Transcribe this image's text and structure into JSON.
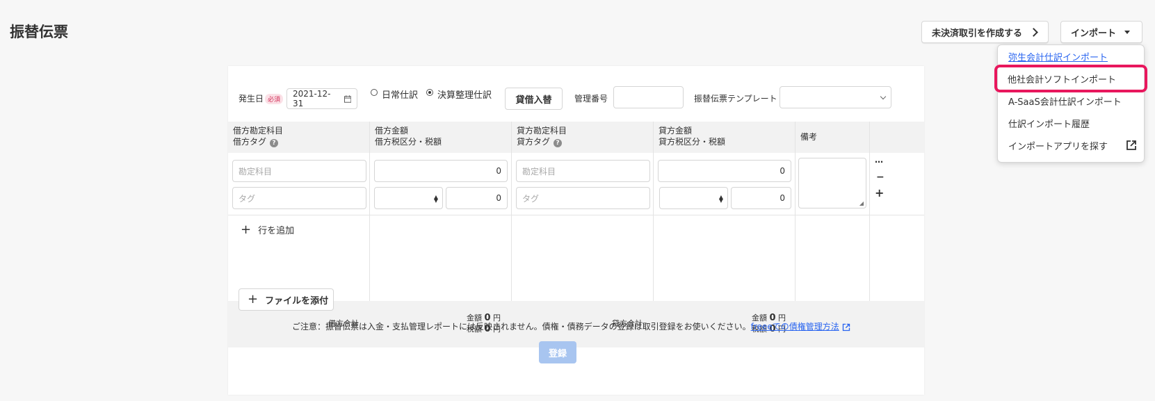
{
  "page": {
    "title": "振替伝票"
  },
  "header": {
    "unsettled_label": "未決済取引を作成する",
    "import_label": "インポート"
  },
  "import_menu": {
    "items": [
      "弥生会計仕訳インポート",
      "他社会計ソフトインポート",
      "A-SaaS会計仕訳インポート",
      "仕訳インポート履歴",
      "インポートアプリを探す"
    ]
  },
  "form": {
    "date_label": "発生日",
    "required_badge": "必須",
    "date_value": "2021-12-31",
    "radio_normal": "日常仕訳",
    "radio_closing": "決算整理仕訳",
    "swap_label": "貸借入替",
    "mgmt_label": "管理番号",
    "template_label": "振替伝票テンプレート"
  },
  "table": {
    "headers": {
      "debit_account": "借方勘定科目",
      "debit_tag": "借方タグ",
      "debit_amount": "借方金額",
      "debit_tax": "借方税区分・税額",
      "credit_account": "貸方勘定科目",
      "credit_tag": "貸方タグ",
      "credit_amount": "貸方金額",
      "credit_tax": "貸方税区分・税額",
      "memo": "備考"
    },
    "row": {
      "account_placeholder": "勘定科目",
      "tag_placeholder": "タグ",
      "amount": "0",
      "tax": "0"
    },
    "add_row_label": "行を追加",
    "totals": {
      "debit_total_label": "借方合計",
      "credit_total_label": "貸方合計",
      "amount_label": "金額",
      "tax_label": "税額",
      "value": "0",
      "unit": "円"
    },
    "row_controls": {
      "more": "…",
      "remove": "−",
      "add": "+"
    }
  },
  "footer": {
    "attach_label": "ファイルを添付",
    "note_text": "ご注意：振替伝票は入金・支払管理レポートには反映されません。債権・債務データの登録は取引登録をお使いください。",
    "note_link": "freeeでの債権管理方法",
    "submit_label": "登録"
  }
}
